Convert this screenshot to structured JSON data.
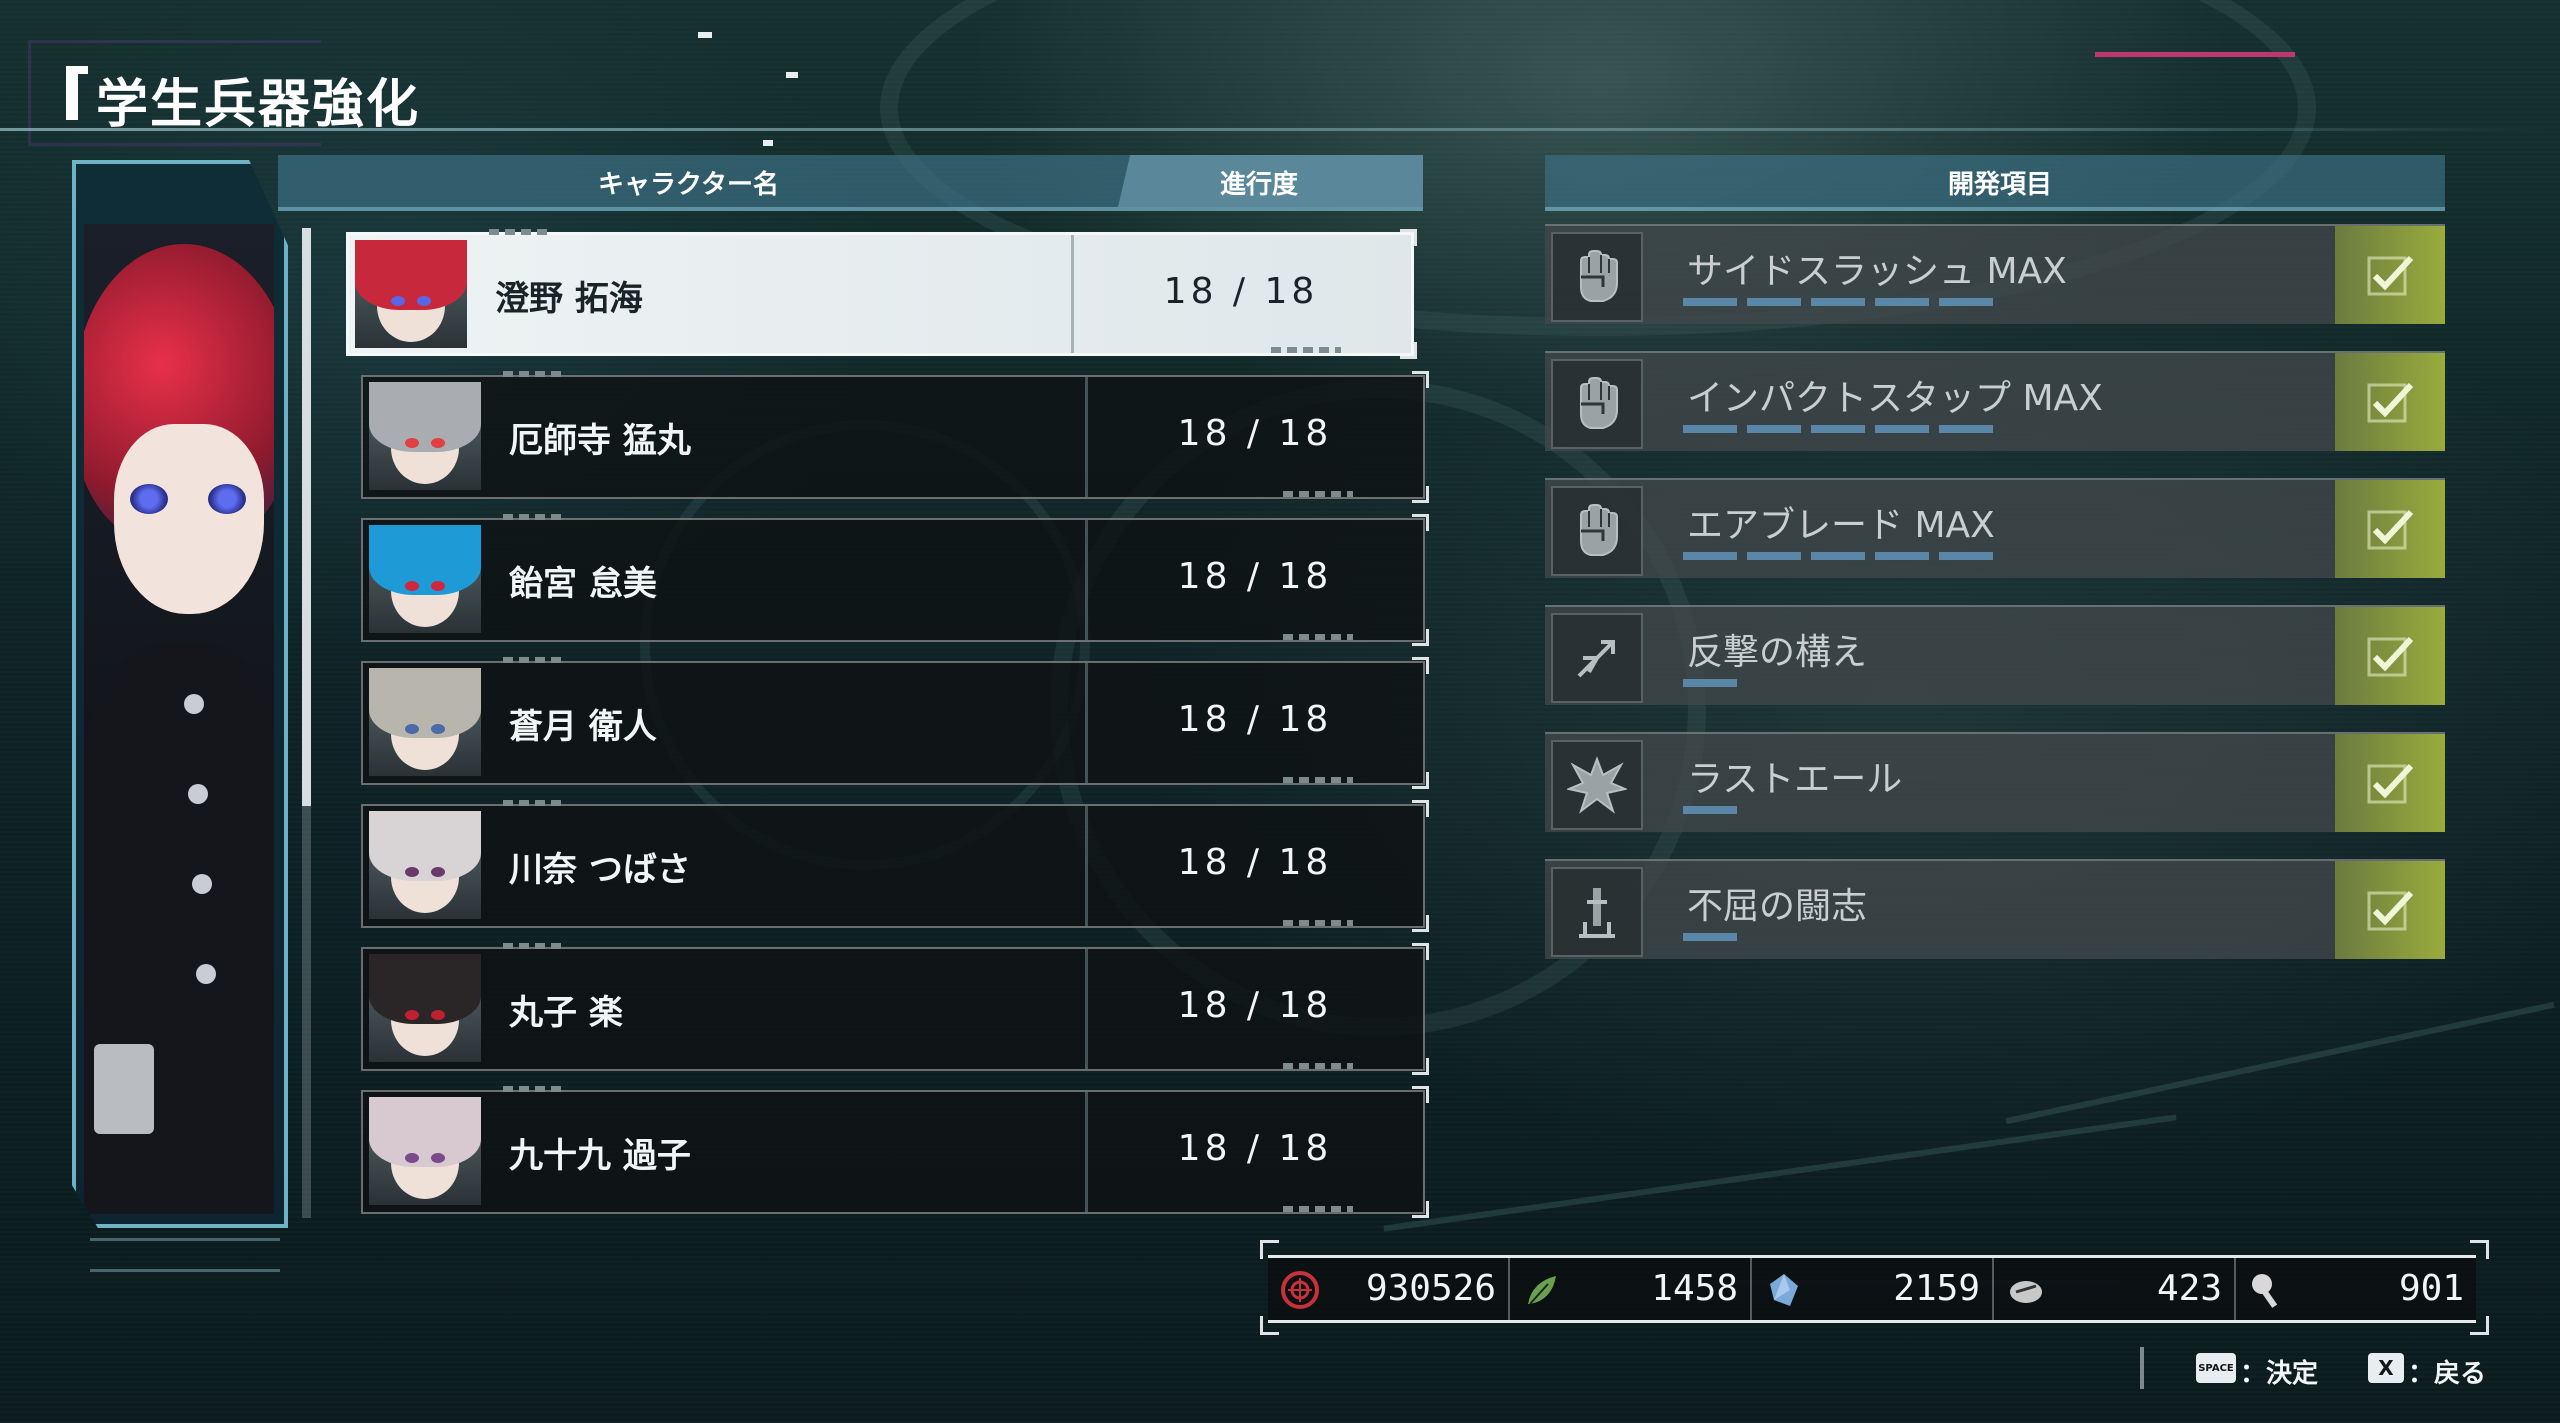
{
  "screen": {
    "title": "学生兵器強化"
  },
  "list": {
    "header_name": "キャラクター名",
    "header_progress": "進行度",
    "characters": [
      {
        "name": "澄野 拓海",
        "progress": "18 / 18",
        "selected": true,
        "hair": "#c8283c",
        "eye": "#5a66e6"
      },
      {
        "name": "厄師寺 猛丸",
        "progress": "18 / 18",
        "selected": false,
        "hair": "#a9adb2",
        "eye": "#e04040"
      },
      {
        "name": "飴宮 怠美",
        "progress": "18 / 18",
        "selected": false,
        "hair": "#1e9ad6",
        "eye": "#d0263e"
      },
      {
        "name": "蒼月 衛人",
        "progress": "18 / 18",
        "selected": false,
        "hair": "#b8b6ac",
        "eye": "#4a6aa8"
      },
      {
        "name": "川奈 つばさ",
        "progress": "18 / 18",
        "selected": false,
        "hair": "#d8d4d6",
        "eye": "#6a3a6a"
      },
      {
        "name": "丸子 楽",
        "progress": "18 / 18",
        "selected": false,
        "hair": "#2a2628",
        "eye": "#c02030"
      },
      {
        "name": "九十九 過子",
        "progress": "18 / 18",
        "selected": false,
        "hair": "#d8c8d0",
        "eye": "#7a4a8a"
      }
    ]
  },
  "development": {
    "header": "開発項目",
    "items": [
      {
        "name": "サイドスラッシュ MAX",
        "icon": "fist-icon",
        "level": 5,
        "complete": true
      },
      {
        "name": "インパクトスタップ MAX",
        "icon": "fist-icon",
        "level": 5,
        "complete": true
      },
      {
        "name": "エアブレード MAX",
        "icon": "fist-icon",
        "level": 5,
        "complete": true
      },
      {
        "name": "反撃の構え",
        "icon": "counter-icon",
        "level": 1,
        "complete": true
      },
      {
        "name": "ラストエール",
        "icon": "burst-icon",
        "level": 1,
        "complete": true
      },
      {
        "name": "不屈の闘志",
        "icon": "fortitude-icon",
        "level": 1,
        "complete": true
      }
    ]
  },
  "currency": [
    {
      "icon": "coin-icon",
      "value": "930526",
      "color": "#c8303a"
    },
    {
      "icon": "leaf-icon",
      "value": "1458",
      "color": "#6aa050"
    },
    {
      "icon": "crystal-icon",
      "value": "2159",
      "color": "#7aa8d8"
    },
    {
      "icon": "ore-icon",
      "value": "423",
      "color": "#c8c8c8"
    },
    {
      "icon": "wrench-icon",
      "value": "901",
      "color": "#d8d8d8"
    }
  ],
  "controls": {
    "confirm_key": "SPACE",
    "confirm_label": "：決定",
    "back_key": "X",
    "back_label": "：戻る"
  },
  "colors": {
    "accent": "#6fb2c6",
    "check": "#b5c53c",
    "highlight_row": "#eef3f4"
  }
}
